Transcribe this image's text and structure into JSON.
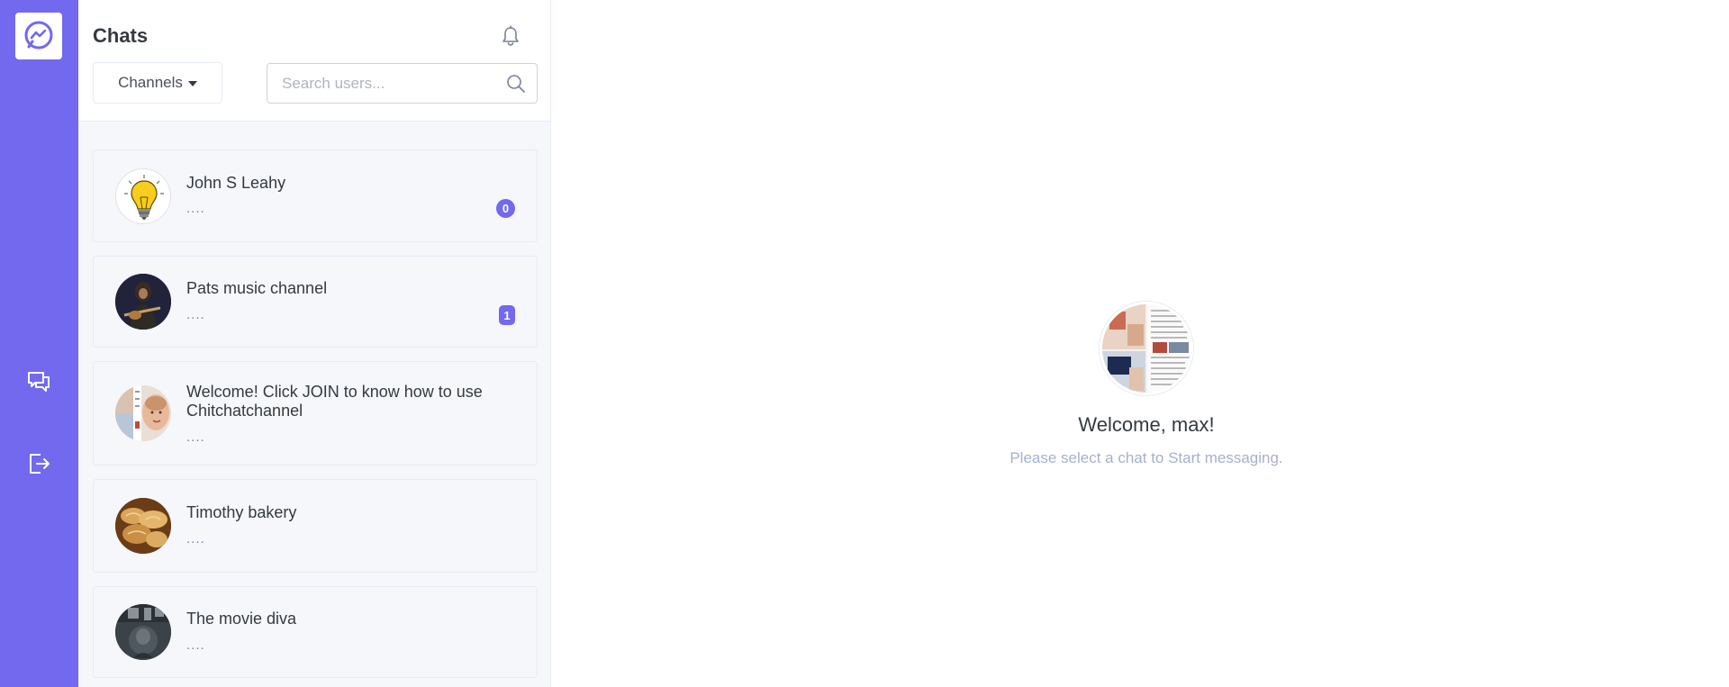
{
  "app": {
    "brand_icon": "messenger-logo-icon",
    "accent_color": "#7269ef"
  },
  "rail": {
    "items": [
      {
        "icon": "chat-bubbles-icon",
        "name": "chats"
      },
      {
        "icon": "logout-icon",
        "name": "logout"
      }
    ]
  },
  "sidebar": {
    "title": "Chats",
    "channels_label": "Channels",
    "search_placeholder": "Search users...",
    "search_value": ""
  },
  "chats": [
    {
      "name": "John S Leahy",
      "preview": "....",
      "badge": "0",
      "avatar": "lightbulb"
    },
    {
      "name": "Pats music channel",
      "preview": "....",
      "badge": "1",
      "avatar": "guitarist"
    },
    {
      "name": "Welcome! Click JOIN to know how to use Chitchatchannel",
      "preview": "....",
      "badge": null,
      "avatar": "collage"
    },
    {
      "name": "Timothy bakery",
      "preview": "....",
      "badge": null,
      "avatar": "bread"
    },
    {
      "name": "The movie diva",
      "preview": "....",
      "badge": null,
      "avatar": "movie"
    }
  ],
  "welcome": {
    "title": "Welcome, max!",
    "subtitle": "Please select a chat to Start messaging."
  }
}
